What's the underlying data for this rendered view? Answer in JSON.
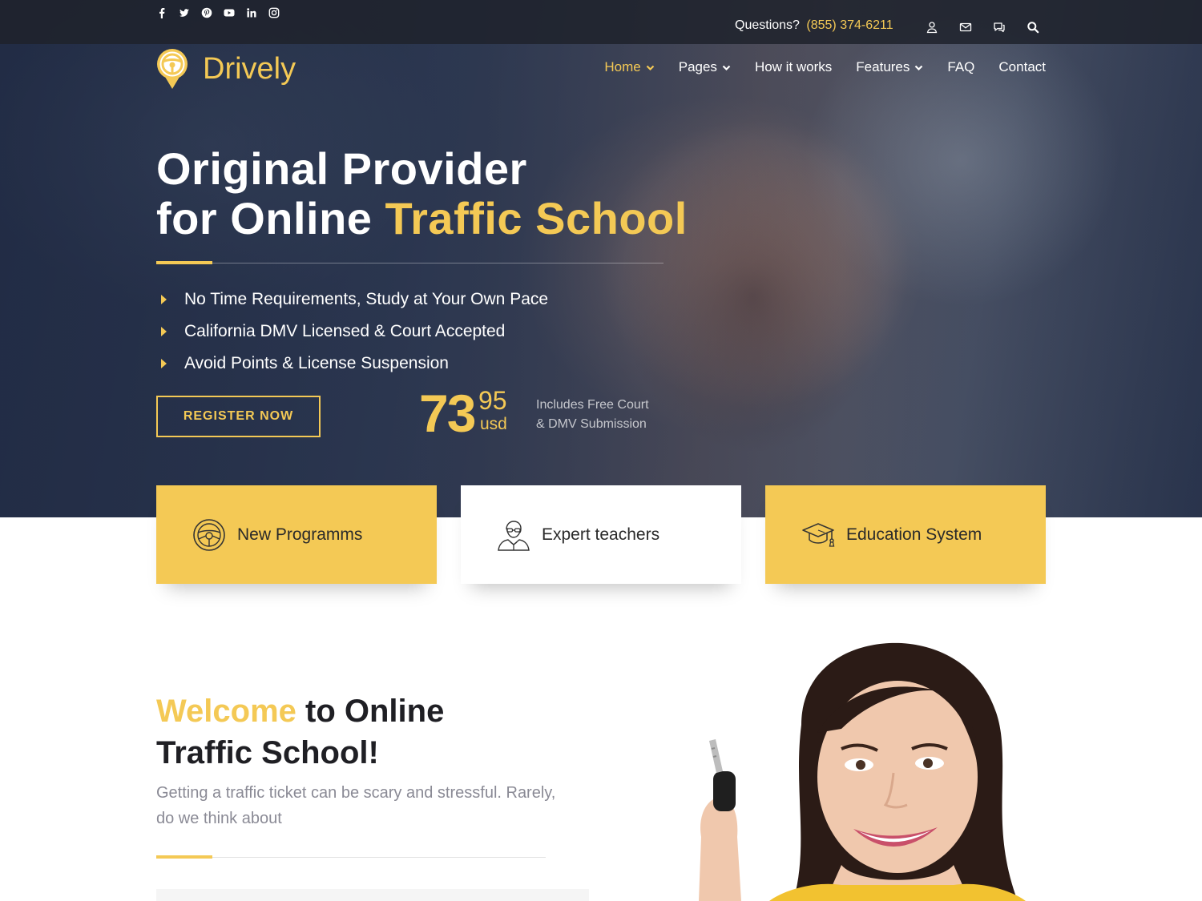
{
  "topbar": {
    "social_icons": [
      "facebook-icon",
      "twitter-icon",
      "pinterest-icon",
      "youtube-icon",
      "linkedin-icon",
      "instagram-icon"
    ],
    "questions_label": "Questions?",
    "phone": "(855) 374-6211",
    "action_icons": [
      "user-icon",
      "mail-icon",
      "chat-icon",
      "search-icon"
    ]
  },
  "brand": {
    "name": "Drively"
  },
  "nav": {
    "items": [
      {
        "label": "Home",
        "dropdown": true,
        "active": true
      },
      {
        "label": "Pages",
        "dropdown": true,
        "active": false
      },
      {
        "label": "How it works",
        "dropdown": false,
        "active": false
      },
      {
        "label": "Features",
        "dropdown": true,
        "active": false
      },
      {
        "label": "FAQ",
        "dropdown": false,
        "active": false
      },
      {
        "label": "Contact",
        "dropdown": false,
        "active": false
      }
    ]
  },
  "hero": {
    "title_line1": "Original Provider",
    "title_line2_plain": "for Online",
    "title_line2_highlight": "Traffic School",
    "features": [
      "No Time Requirements, Study at Your Own Pace",
      "California DMV Licensed & Court Accepted",
      "Avoid Points & License Suspension"
    ],
    "register_label": "REGISTER NOW",
    "price_main": "73",
    "price_cents": "95",
    "price_currency": "usd",
    "price_note_line1": "Includes Free Court",
    "price_note_line2": "& DMV Submission"
  },
  "cards": [
    {
      "label": "New Programms",
      "icon": "steering-wheel-icon",
      "style": "yellow"
    },
    {
      "label": "Expert teachers",
      "icon": "teacher-icon",
      "style": "white"
    },
    {
      "label": "Education System",
      "icon": "graduation-cap-icon",
      "style": "yellow"
    }
  ],
  "welcome": {
    "title_highlight": "Welcome",
    "title_rest_line1": "to Online",
    "title_line2": "Traffic School!",
    "text": "Getting a traffic ticket can be scary and stressful. Rarely, do we think about"
  },
  "colors": {
    "accent": "#f4c955",
    "topbar": "#1e222c",
    "heading_dark": "#1f1f24",
    "body_gray": "#8a8a95"
  }
}
